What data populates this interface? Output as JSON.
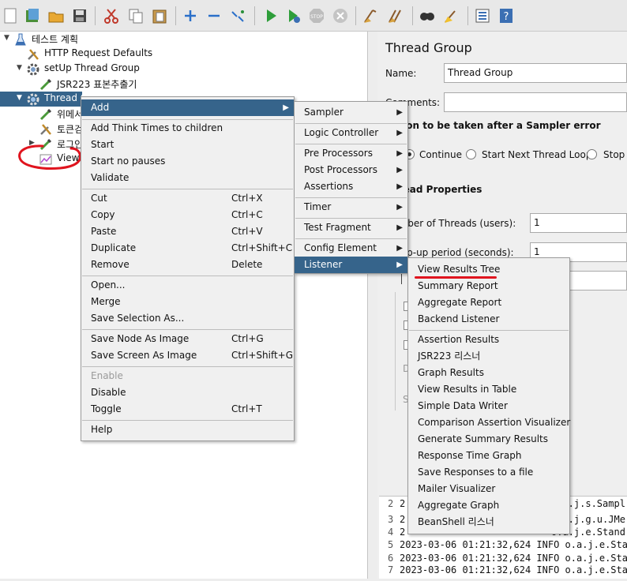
{
  "toolbar": {
    "icons": [
      "new-icon",
      "templates-icon",
      "open-icon",
      "save-icon",
      "cut-icon",
      "copy-icon",
      "paste-icon",
      "expand-icon",
      "collapse-icon",
      "toggle-icon",
      "start-icon",
      "start-no-pauses-icon",
      "stop-icon",
      "shutdown-icon",
      "clear-icon",
      "clear-all-icon",
      "search-icon",
      "reset-search-icon",
      "function-helper-icon",
      "help-icon"
    ]
  },
  "tree": {
    "nodes": [
      {
        "label": "테스트 계획",
        "icon": "flask-icon"
      },
      {
        "label": "HTTP Request Defaults",
        "icon": "wrench-icon"
      },
      {
        "label": "setUp Thread Group",
        "icon": "gear-icon"
      },
      {
        "label": "JSR223 표본추출기",
        "icon": "pipette-icon"
      },
      {
        "label": "Thread G",
        "icon": "gear-icon"
      },
      {
        "label": "위메서",
        "icon": "pipette-icon"
      },
      {
        "label": "토큰검",
        "icon": "wrench-icon"
      },
      {
        "label": "로그인",
        "icon": "pipette-icon"
      },
      {
        "label": "View",
        "icon": "graph-icon"
      }
    ]
  },
  "right": {
    "title": "Thread Group",
    "name_label": "Name:",
    "name_value": "Thread Group",
    "comments_label": "Comments:",
    "error_section": "Action to be taken after a Sampler error",
    "radio_continue": "Continue",
    "radio_next_loop": "Start Next Thread Loop",
    "radio_stop": "Stop T",
    "props_section": "Thread Properties",
    "threads_label": "Number of Threads (users):",
    "threads_value": "1",
    "rampup_label": "Ramp-up period (seconds):",
    "rampup_value": "1",
    "frag_d": "D",
    "frag_s": "S"
  },
  "log": {
    "lines": [
      {
        "num": "2",
        "text": "2",
        "tail": "o.a.j.s.Sampl"
      },
      {
        "num": "3",
        "text": "2",
        "tail": "o.a.j.g.u.JMe"
      },
      {
        "num": "4",
        "text": "2",
        "tail": "o.a.j.e.Stand"
      },
      {
        "num": "5",
        "text": "2023-03-06 01:21:32,624 INFO o.a.j.e.Stand"
      },
      {
        "num": "6",
        "text": "2023-03-06 01:21:32,624 INFO o.a.j.e.Stand"
      },
      {
        "num": "7",
        "text": "2023-03-06 01:21:32,624 INFO o.a.j.e.Stand"
      }
    ]
  },
  "context_menu": {
    "add": "Add",
    "add_think_times": "Add Think Times to children",
    "start": "Start",
    "start_no_pauses": "Start no pauses",
    "validate": "Validate",
    "cut": "Cut",
    "cut_sc": "Ctrl+X",
    "copy": "Copy",
    "copy_sc": "Ctrl+C",
    "paste": "Paste",
    "paste_sc": "Ctrl+V",
    "duplicate": "Duplicate",
    "duplicate_sc": "Ctrl+Shift+C",
    "remove": "Remove",
    "remove_sc": "Delete",
    "open": "Open...",
    "merge": "Merge",
    "save_selection": "Save Selection As...",
    "save_node_image": "Save Node As Image",
    "save_node_image_sc": "Ctrl+G",
    "save_screen_image": "Save Screen As Image",
    "save_screen_image_sc": "Ctrl+Shift+G",
    "enable": "Enable",
    "disable": "Disable",
    "toggle": "Toggle",
    "toggle_sc": "Ctrl+T",
    "help": "Help"
  },
  "add_menu": {
    "sampler": "Sampler",
    "logic_controller": "Logic Controller",
    "pre_processors": "Pre Processors",
    "post_processors": "Post Processors",
    "assertions": "Assertions",
    "timer": "Timer",
    "test_fragment": "Test Fragment",
    "config_element": "Config Element",
    "listener": "Listener"
  },
  "listener_menu": {
    "items": [
      "View Results Tree",
      "Summary Report",
      "Aggregate Report",
      "Backend Listener",
      "Assertion Results",
      "JSR223 리스너",
      "Graph Results",
      "View Results in Table",
      "Simple Data Writer",
      "Comparison Assertion Visualizer",
      "Generate Summary Results",
      "Response Time Graph",
      "Save Responses to a file",
      "Mailer Visualizer",
      "Aggregate Graph",
      "BeanShell 리스너"
    ]
  },
  "colors": {
    "selection": "#36648b",
    "annotation": "#e0141e"
  }
}
